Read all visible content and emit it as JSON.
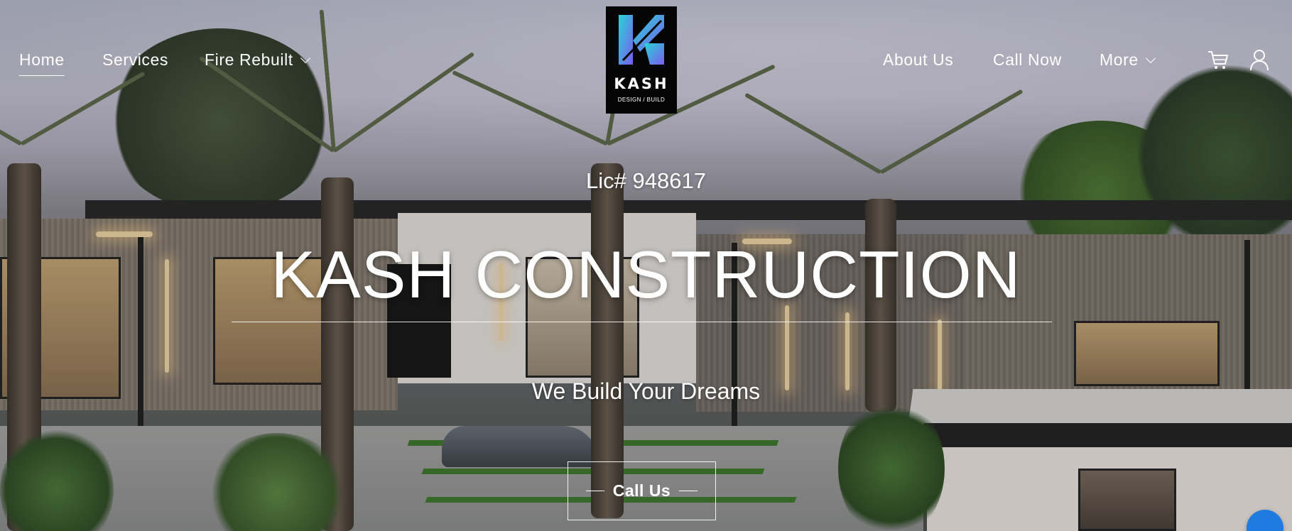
{
  "nav": {
    "left": [
      {
        "label": "Home",
        "active": true
      },
      {
        "label": "Services"
      },
      {
        "label": "Fire Rebuilt",
        "has_dropdown": true
      }
    ],
    "right": [
      {
        "label": "About Us"
      },
      {
        "label": "Call Now"
      },
      {
        "label": "More",
        "has_dropdown": true
      }
    ],
    "icons": [
      "cart-icon",
      "user-icon"
    ]
  },
  "logo": {
    "wordmark": "KASH",
    "subtitle": "DESIGN / BUILD",
    "colors": {
      "background": "#050505",
      "gradient_start": "#27d6d6",
      "gradient_end": "#7b5cf0"
    }
  },
  "hero": {
    "license": "Lic# 948617",
    "headline": "KASH CONSTRUCTION",
    "tagline": "We Build Your Dreams",
    "cta_label": "Call Us"
  },
  "colors": {
    "text": "#ffffff",
    "chat_accent": "#1f7be0"
  }
}
